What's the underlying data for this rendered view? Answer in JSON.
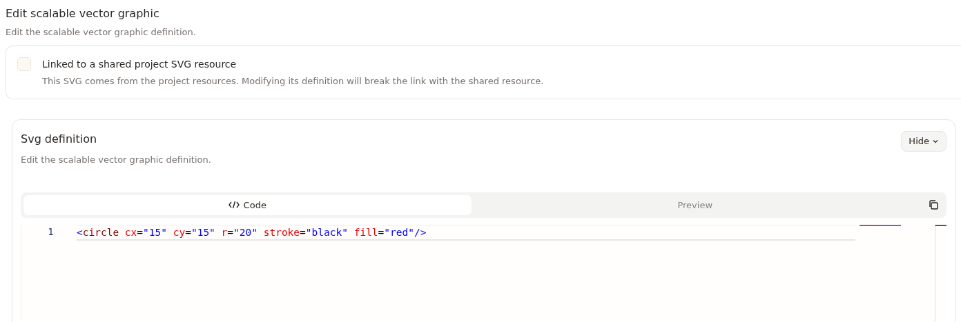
{
  "header": {
    "title": "Edit scalable vector graphic",
    "subtitle": "Edit the scalable vector graphic definition."
  },
  "linked": {
    "checked": false,
    "label": "Linked to a shared project SVG resource",
    "help": "This SVG comes from the project resources. Modifying its definition will break the link with the shared resource."
  },
  "definition": {
    "title": "Svg definition",
    "subtitle": "Edit the scalable vector graphic definition.",
    "toggle_button": "Hide",
    "tabs": [
      {
        "label": "Code",
        "selected": true
      },
      {
        "label": "Preview",
        "selected": false
      }
    ],
    "editor": {
      "lines": [
        {
          "number": "1",
          "open": "<",
          "tag": "circle",
          "close": "/>",
          "attributes": [
            {
              "name": "cx",
              "equals": "=",
              "value": "\"15\""
            },
            {
              "name": "cy",
              "equals": "=",
              "value": "\"15\""
            },
            {
              "name": "r",
              "equals": "=",
              "value": "\"20\""
            },
            {
              "name": "stroke",
              "equals": "=",
              "value": "\"black\""
            },
            {
              "name": "fill",
              "equals": "=",
              "value": "\"red\""
            }
          ]
        }
      ]
    }
  }
}
